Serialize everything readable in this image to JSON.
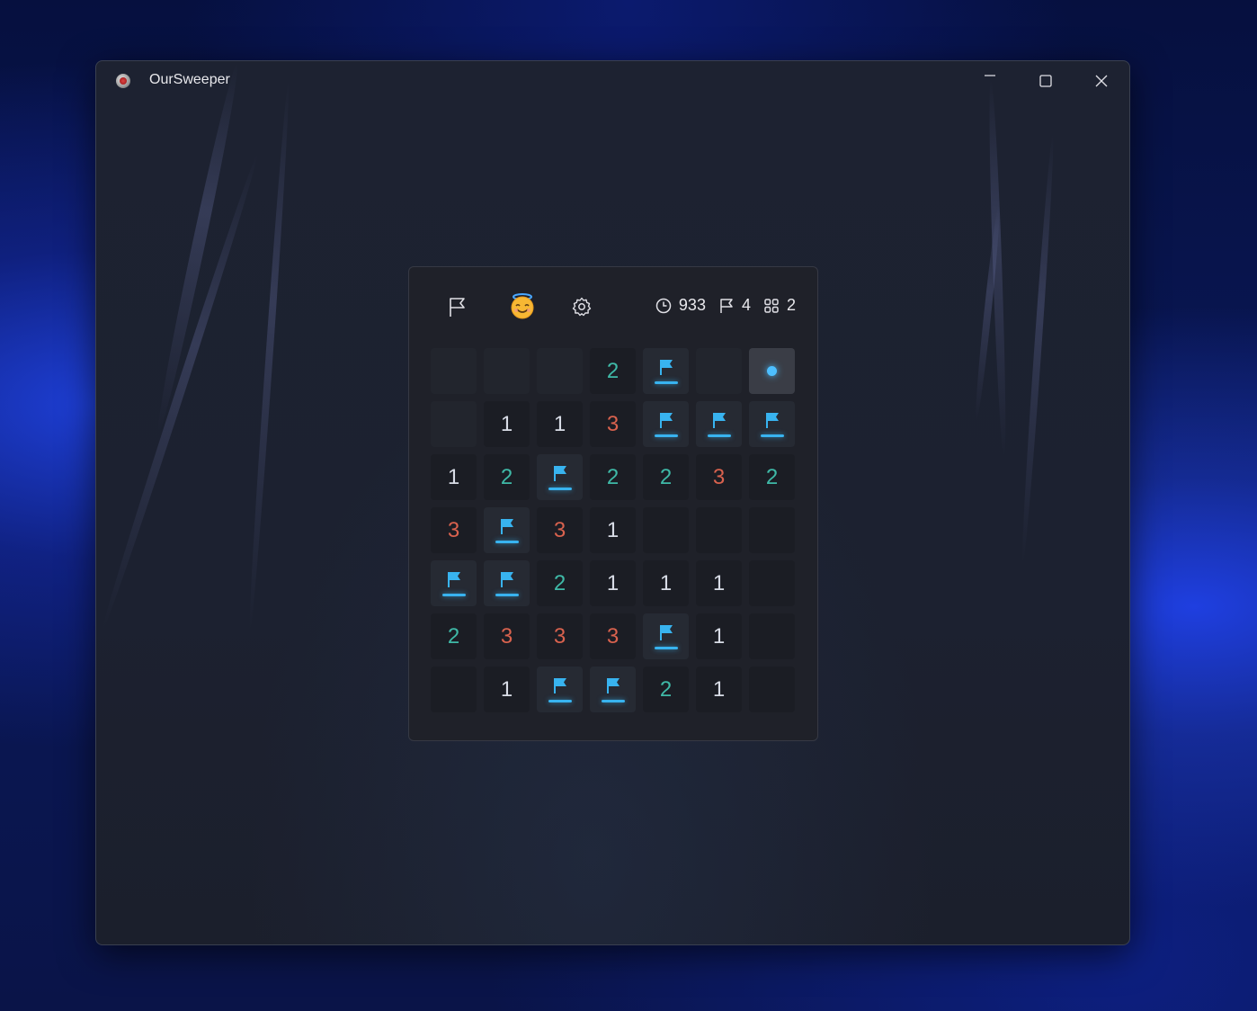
{
  "window": {
    "title": "OurSweeper",
    "controls": [
      "minimize",
      "maximize",
      "close"
    ]
  },
  "toolbar": {
    "flag_mode_icon": "flag-icon",
    "face_icon": "angel-face-emoji",
    "settings_icon": "gear-icon",
    "timer_icon": "clock-icon",
    "timer_value": "933",
    "flags_icon": "flag-outline-icon",
    "flags_count": "4",
    "players_icon": "grid-icon",
    "players_count": "2"
  },
  "board": {
    "rows": 7,
    "cols": 7,
    "cells": [
      [
        "hidden",
        "hidden",
        "hidden",
        "2",
        "flag",
        "hidden",
        "cursor"
      ],
      [
        "hidden",
        "1",
        "1",
        "3",
        "flag",
        "flag",
        "flag"
      ],
      [
        "1",
        "2",
        "flag",
        "2",
        "2",
        "3",
        "2"
      ],
      [
        "3",
        "flag",
        "3",
        "1",
        "empty",
        "empty",
        "empty"
      ],
      [
        "flag",
        "flag",
        "2",
        "1",
        "1",
        "1",
        "empty"
      ],
      [
        "2",
        "3",
        "3",
        "3",
        "flag",
        "1",
        "empty"
      ],
      [
        "empty",
        "1",
        "flag",
        "flag",
        "2",
        "1",
        "empty"
      ]
    ]
  },
  "colors": {
    "flag": "#38b3ef",
    "n1": "#d8dce6",
    "n2": "#3fb9a7",
    "n3": "#d9624e"
  }
}
